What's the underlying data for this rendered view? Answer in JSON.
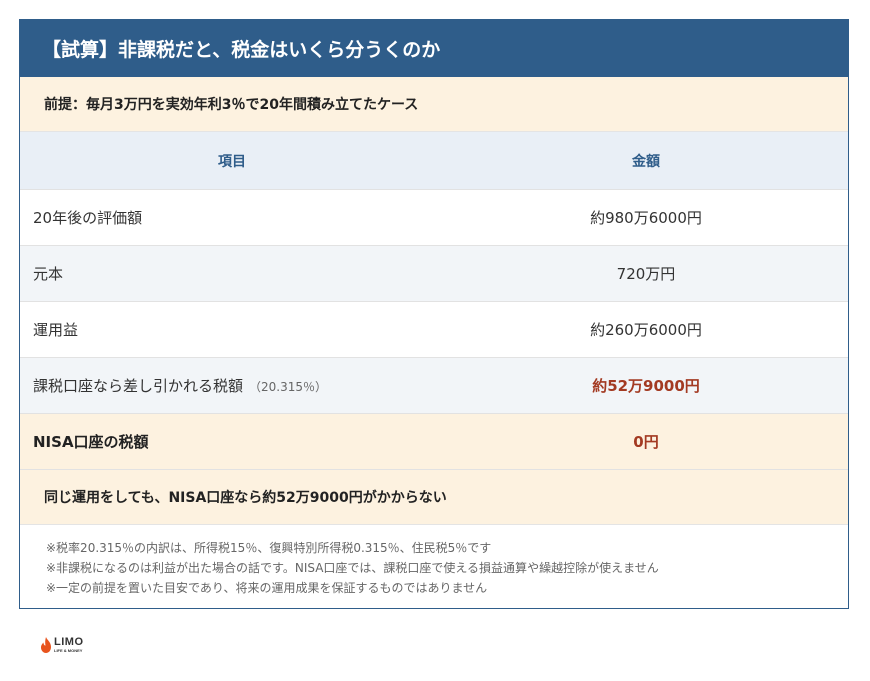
{
  "title": "【試算】非課税だと、税金はいくら分うくのか",
  "premise": "前提：毎月3万円を実効年利3％で20年間積み立てたケース",
  "table": {
    "headers": {
      "item": "項目",
      "amount": "金額"
    },
    "rows": [
      {
        "item": "20年後の評価額",
        "amount": "約980万6000円"
      },
      {
        "item": "元本",
        "amount": "720万円"
      },
      {
        "item": "運用益",
        "amount": "約260万6000円"
      },
      {
        "item": "課税口座なら差し引かれる税額",
        "note": "（20.315％）",
        "amount": "約52万9000円"
      },
      {
        "item": "NISA口座の税額",
        "amount": "0円"
      }
    ]
  },
  "summary": "同じ運用をしても、NISA口座なら約52万9000円がかからない",
  "notes": [
    "※税率20.315％の内訳は、所得税15％、復興特別所得税0.315％、住民税5％です",
    "※非課税になるのは利益が出た場合の話です。NISA口座では、課税口座で使える損益通算や繰越控除が使えません",
    "※一定の前提を置いた目安であり、将来の運用成果を保証するものではありません"
  ],
  "logo": {
    "name": "LIMO",
    "tagline": "LIFE & MONEY"
  },
  "colors": {
    "header_blue": "#2f5d8a",
    "cream": "#fdf2e0",
    "highlight_red": "#a33a22",
    "logo_orange": "#e8541e"
  },
  "icons": {
    "logo": "flame-logo-icon"
  }
}
